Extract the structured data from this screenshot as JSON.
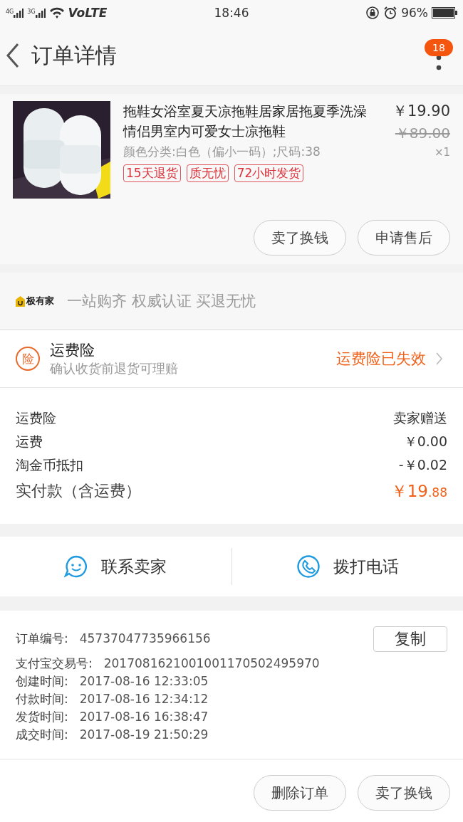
{
  "status_bar": {
    "signal_labels": [
      "4G",
      "3G"
    ],
    "network": "VoLTE",
    "time": "18:46",
    "battery": "96%"
  },
  "header": {
    "title": "订单详情",
    "badge": "18"
  },
  "product": {
    "title": "拖鞋女浴室夏天凉拖鞋居家居拖夏季洗澡情侣男室内可爱女士凉拖鞋",
    "variant": "颜色分类:白色（偏小一码）;尺码:38",
    "price": "￥19.90",
    "original_price": "￥89.00",
    "quantity": "×1",
    "tags": [
      "15天退货",
      "质无忧",
      "72小时发货"
    ],
    "buttons": [
      "卖了换钱",
      "申请售后"
    ]
  },
  "brand_banner": {
    "brand": "极有家",
    "slogan": "一站购齐 权威认证 买退无忧"
  },
  "insurance": {
    "icon_text": "险",
    "title": "运费险",
    "subtitle": "确认收货前退货可理赔",
    "status": "运费险已失效"
  },
  "fees": [
    {
      "label": "运费险",
      "value": "卖家赠送"
    },
    {
      "label": "运费",
      "value": "￥0.00"
    },
    {
      "label": "淘金币抵扣",
      "value": "-￥0.02"
    }
  ],
  "total": {
    "label": "实付款（含运费）",
    "value_main": "￥19",
    "value_fraction": ".88"
  },
  "contact": [
    {
      "kind": "chat",
      "label": "联系卖家"
    },
    {
      "kind": "phone",
      "label": "拨打电话"
    }
  ],
  "order_info": {
    "copy_button": "复制",
    "rows": [
      {
        "label": "订单编号:",
        "value": "45737047735966156"
      },
      {
        "label": "支付宝交易号:",
        "value": "2017081621001001170502495970"
      },
      {
        "label": "创建时间:",
        "value": "2017-08-16 12:33:05"
      },
      {
        "label": "付款时间:",
        "value": "2017-08-16 12:34:12"
      },
      {
        "label": "发货时间:",
        "value": "2017-08-16 16:38:47"
      },
      {
        "label": "成交时间:",
        "value": "2017-08-19 21:50:29"
      }
    ]
  },
  "footer_buttons": [
    "删除订单",
    "卖了换钱"
  ]
}
